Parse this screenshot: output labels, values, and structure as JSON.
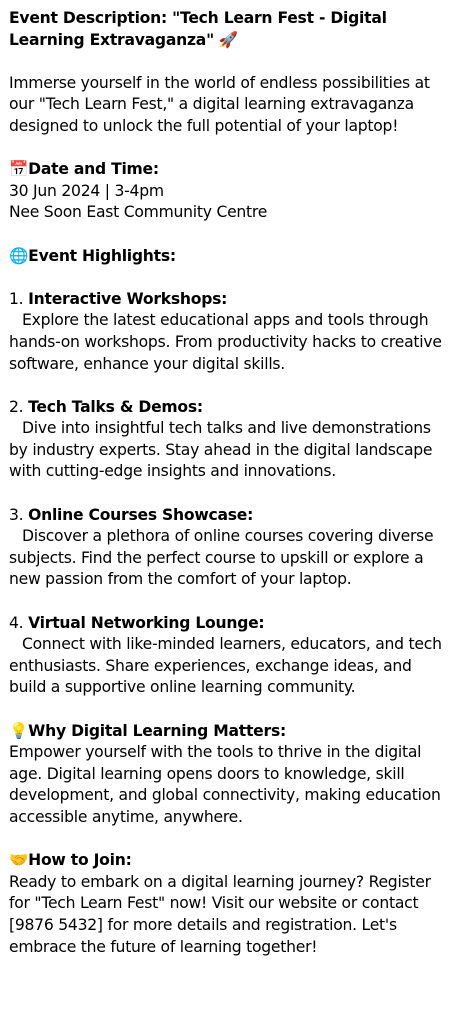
{
  "title": {
    "text": "Event Description: \"Tech Learn Fest - Digital Learning Extravaganza\"",
    "emoji": "🚀"
  },
  "intro": "Immerse yourself in the world of endless possibilities at our \"Tech Learn Fest,\" a digital learning extravaganza designed to unlock the full potential of your laptop!",
  "date_time": {
    "emoji": "📅",
    "heading": "Date and Time:",
    "date": "30 Jun 2024 | 3-4pm",
    "venue": "Nee Soon East Community Centre"
  },
  "highlights": {
    "emoji": "🌐",
    "heading": "Event Highlights:",
    "items": [
      {
        "number": "1.",
        "title": "Interactive Workshops:",
        "text": "Explore the latest educational apps and tools through hands-on workshops. From productivity hacks to creative software, enhance your digital skills."
      },
      {
        "number": "2.",
        "title": "Tech Talks & Demos:",
        "text": "Dive into insightful tech talks and live demonstrations by industry experts. Stay ahead in the digital landscape with cutting-edge insights and innovations."
      },
      {
        "number": "3.",
        "title": "Online Courses Showcase:",
        "text": "Discover a plethora of online courses covering diverse subjects. Find the perfect course to upskill or explore a new passion from the comfort of your laptop."
      },
      {
        "number": "4.",
        "title": "Virtual Networking Lounge:",
        "text": "Connect with like-minded learners, educators, and tech enthusiasts. Share experiences, exchange ideas, and build a supportive online learning community."
      }
    ]
  },
  "why": {
    "emoji": "💡",
    "heading": "Why Digital Learning Matters:",
    "text": "Empower yourself with the tools to thrive in the digital age. Digital learning opens doors to knowledge, skill development, and global connectivity, making education accessible anytime, anywhere."
  },
  "join": {
    "emoji": "🤝",
    "heading": "How to Join:",
    "text": "Ready to embark on a digital learning journey? Register for \"Tech Learn Fest\" now! Visit our website or contact [9876 5432] for more details and registration. Let's embrace the future of learning together!"
  }
}
